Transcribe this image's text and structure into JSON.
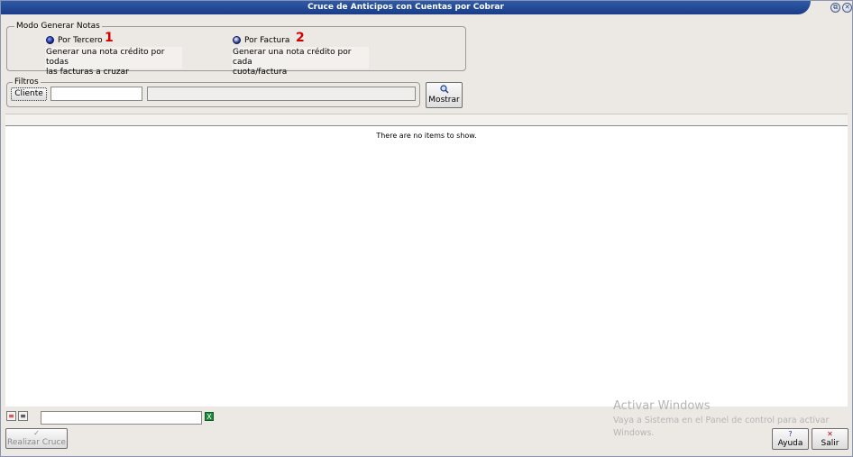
{
  "window": {
    "title": "Cruce de Anticipos con Cuentas por Cobrar",
    "restore_glyph": "⧉",
    "close_glyph": "✕"
  },
  "modo": {
    "legend": "Modo Generar Notas",
    "option1": {
      "label": "Por Tercero",
      "selected": true,
      "description_line1": "Generar una nota crédito por todas",
      "description_line2": "las facturas a cruzar",
      "annotation": "1"
    },
    "option2": {
      "label": "Por Factura",
      "selected": false,
      "description_line1": "Generar una nota crédito por cada",
      "description_line2": "cuota/factura",
      "annotation": "2"
    }
  },
  "filtros": {
    "legend": "Filtros",
    "cliente_button": "Cliente",
    "cliente_code": "",
    "cliente_name": ""
  },
  "mostrar_button": {
    "label": "Mostrar",
    "icon": "search-icon"
  },
  "grid": {
    "empty_message": "There are no items to show."
  },
  "bottom": {
    "search_value": "",
    "excel_icon": "excel-icon",
    "realizar_cruce": "Realizar Cruce",
    "ayuda": "Ayuda",
    "salir": "Salir"
  },
  "watermark": {
    "title": "Activar Windows",
    "line1": "Vaya a Sistema en el Panel de control para activar",
    "line2": "Windows."
  }
}
